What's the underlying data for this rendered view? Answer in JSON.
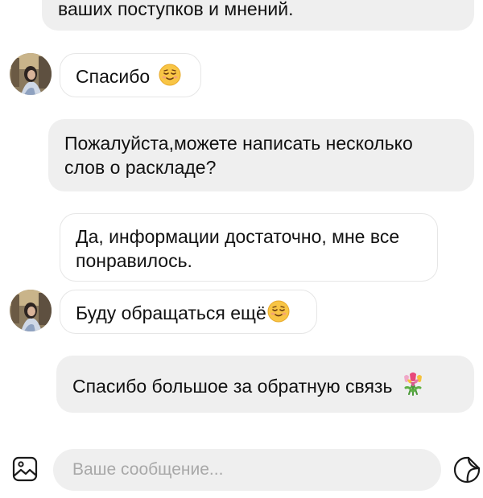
{
  "messages": {
    "m0": "ваших поступков и мнений.",
    "m1": "Спасибо",
    "m2": "Пожалуйста,можете написать несколько слов о раскладе?",
    "m3": "Да, информации достаточно, мне все понравилось.",
    "m4": "Буду обращаться ещё",
    "m5": "Спасибо большое за обратную связь"
  },
  "composer": {
    "placeholder": "Ваше сообщение..."
  },
  "icons": {
    "attach": "image-icon",
    "sticker": "sticker-icon",
    "emoji_smile": "relieved-face-emoji",
    "emoji_flowers": "tulip-bouquet-emoji"
  },
  "colors": {
    "outgoing_bubble": "#efefef",
    "incoming_bubble": "#ffffff",
    "placeholder": "#a8a8a8"
  }
}
